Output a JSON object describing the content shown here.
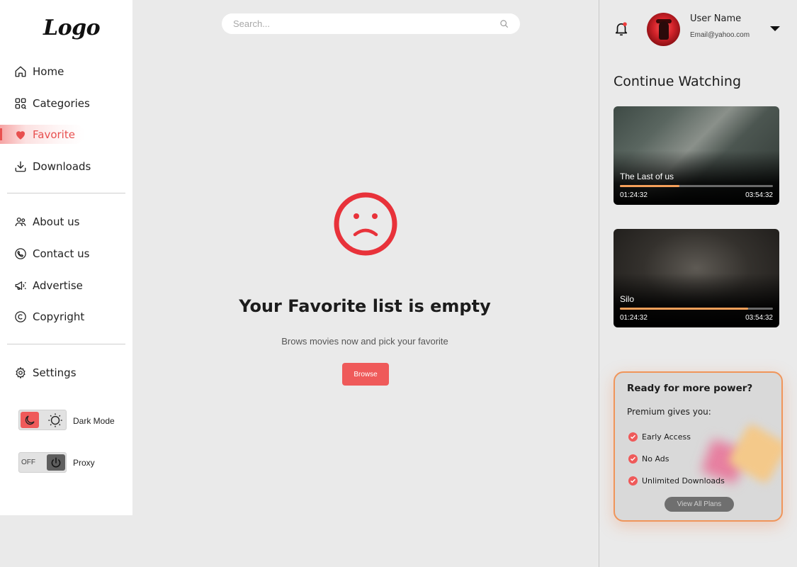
{
  "logo": "Logo",
  "search": {
    "placeholder": "Search..."
  },
  "nav": {
    "main": [
      {
        "label": "Home",
        "icon": "home-icon"
      },
      {
        "label": "Categories",
        "icon": "categories-icon"
      },
      {
        "label": "Favorite",
        "icon": "heart-icon",
        "active": true
      },
      {
        "label": "Downloads",
        "icon": "download-icon"
      }
    ],
    "info": [
      {
        "label": "About us",
        "icon": "people-icon"
      },
      {
        "label": "Contact us",
        "icon": "phone-icon"
      },
      {
        "label": "Advertise",
        "icon": "megaphone-icon"
      },
      {
        "label": "Copyright",
        "icon": "copyright-icon"
      }
    ],
    "settings": {
      "label": "Settings",
      "icon": "gear-icon"
    }
  },
  "toggles": {
    "dark_mode": {
      "label": "Dark Mode"
    },
    "proxy": {
      "label": "Proxy",
      "state_text": "OFF"
    }
  },
  "empty_state": {
    "title": "Your Favorite list is empty",
    "subtitle": "Brows movies now and pick your favorite",
    "button": "Browse"
  },
  "user": {
    "name": "User Name",
    "email": "Email@yahoo.com"
  },
  "continue_watching": {
    "title": "Continue Watching",
    "items": [
      {
        "title": "The Last of us",
        "elapsed": "01:24:32",
        "total": "03:54:32",
        "progress": 0.39
      },
      {
        "title": "Silo",
        "elapsed": "01:24:32",
        "total": "03:54:32",
        "progress": 0.84
      }
    ]
  },
  "premium": {
    "title": "Ready for more power?",
    "subtitle": "Premium gives you:",
    "features": [
      "Early Access",
      "No Ads",
      "Unlimited Downloads"
    ],
    "button": "View All Plans"
  },
  "colors": {
    "accent": "#ef5a5a",
    "progress": "#f5a05a",
    "premium_border": "#f0955a"
  }
}
